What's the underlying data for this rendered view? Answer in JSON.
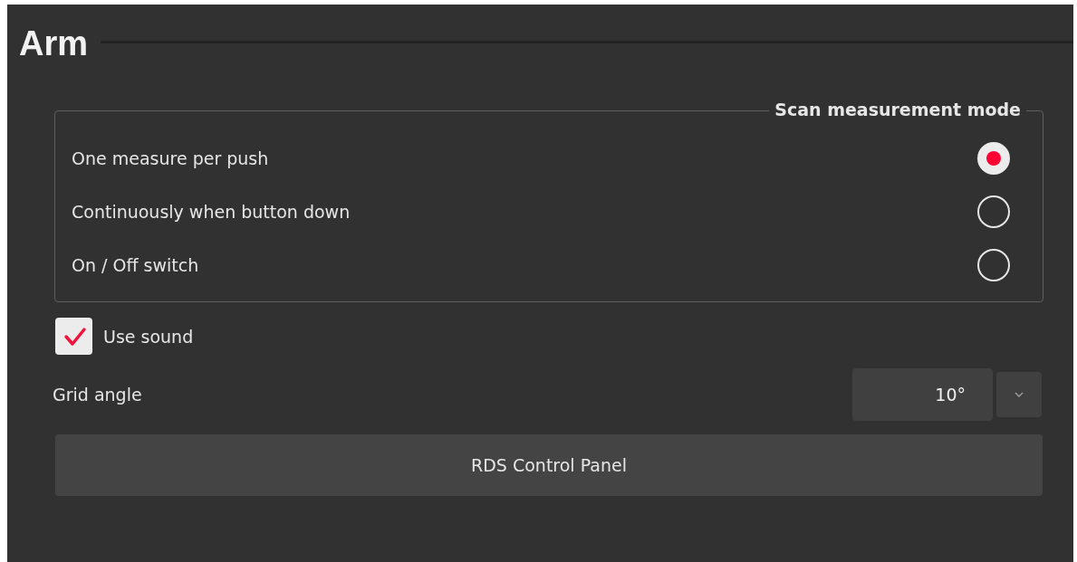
{
  "section": {
    "title": "Arm"
  },
  "scan_mode": {
    "title": "Scan measurement mode",
    "options": [
      {
        "label": "One measure per push",
        "selected": true
      },
      {
        "label": "Continuously when button down",
        "selected": false
      },
      {
        "label": "On / Off switch",
        "selected": false
      }
    ]
  },
  "use_sound": {
    "label": "Use sound",
    "checked": true
  },
  "grid_angle": {
    "label": "Grid angle",
    "value": "10°"
  },
  "buttons": [
    "RDS Control Panel"
  ]
}
